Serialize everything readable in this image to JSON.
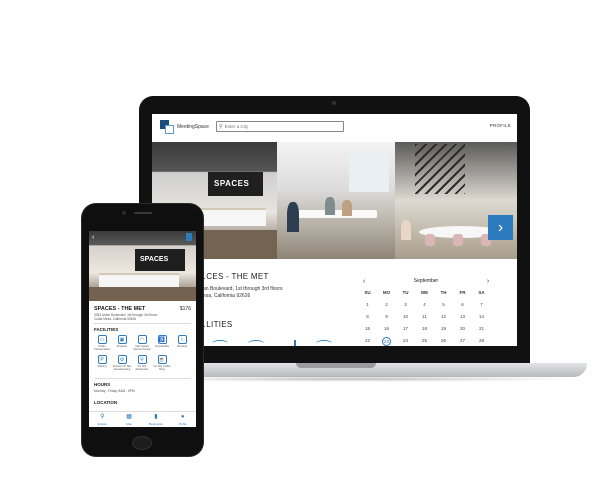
{
  "laptop": {
    "app_name": "MeetingSpace",
    "search": {
      "placeholder": "Enter a City"
    },
    "profile_label": "PROFILE",
    "gallery_prev": "‹",
    "gallery_next": "›",
    "photo_sign": "SPACES",
    "venue": {
      "title": "…CES - THE MET",
      "address_line1": "…an Boulevard, 1st through 3rd floors",
      "address_line2": "…esa, California 92626"
    },
    "facilities_heading": "…LITIES",
    "calendar": {
      "month": "September",
      "prev": "‹",
      "next": "›",
      "weekdays": [
        "SU",
        "MO",
        "TU",
        "WE",
        "TH",
        "FR",
        "SA"
      ],
      "weeks": [
        [
          "1",
          "2",
          "3",
          "4",
          "5",
          "6",
          "7"
        ],
        [
          "8",
          "9",
          "10",
          "11",
          "12",
          "13",
          "14"
        ],
        [
          "15",
          "16",
          "17",
          "18",
          "19",
          "20",
          "21"
        ],
        [
          "22",
          "23",
          "24",
          "25",
          "26",
          "27",
          "28"
        ]
      ],
      "highlighted": "23"
    }
  },
  "mobile": {
    "back": "‹",
    "photo_sign": "SPACES",
    "title": "SPACES - THE MET",
    "price": "$176",
    "address_line1": "3353 Anton Boulevard, 1st through 3rd floors",
    "address_line2": "Costa Mesa, California 92626",
    "facilities_heading": "FACILITIES",
    "facilities": [
      {
        "icon": "public-transit-icon",
        "glyph": "▭",
        "label": "Public Transportation"
      },
      {
        "icon": "projector-icon",
        "glyph": "▣",
        "label": "Projector"
      },
      {
        "icon": "wifi-icon",
        "glyph": "◠",
        "label": "High Speed Internet Access"
      },
      {
        "icon": "accessibility-icon",
        "glyph": "♿",
        "label": "Accessibility"
      },
      {
        "icon": "showers-icon",
        "glyph": "⌇",
        "label": "Showers"
      },
      {
        "icon": "parking-icon",
        "glyph": "P",
        "label": "Parking"
      },
      {
        "icon": "housekeeping-icon",
        "glyph": "⚙",
        "label": "24 Hour On Site Housekeeping"
      },
      {
        "icon": "restaurant-icon",
        "glyph": "⚲",
        "label": "On Site Restaurant"
      },
      {
        "icon": "coffee-icon",
        "glyph": "☕",
        "label": "On Site Coffee Shop"
      }
    ],
    "hours_heading": "HOURS",
    "hours_value": "Monday - Friday, 8AM - 6PM",
    "location_heading": "LOCATION",
    "tabs": [
      {
        "icon": "search-icon",
        "glyph": "⚲",
        "label": "Explore"
      },
      {
        "icon": "map-icon",
        "glyph": "▦",
        "label": "Map"
      },
      {
        "icon": "bookmark-icon",
        "glyph": "▮",
        "label": "Bookmarks"
      },
      {
        "icon": "profile-icon",
        "glyph": "●",
        "label": "Profile"
      }
    ]
  },
  "colors": {
    "accent": "#2d7bbf",
    "device": "#111111",
    "logo_dark": "#1b4d7a"
  }
}
